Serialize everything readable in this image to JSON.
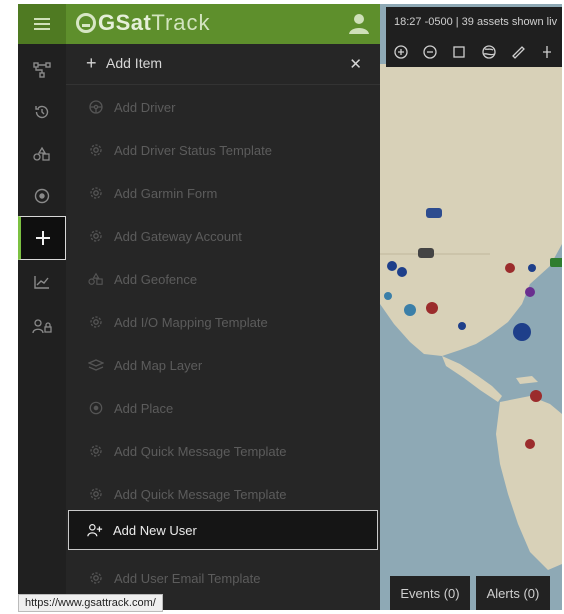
{
  "app": {
    "logo_part1": "GSat",
    "logo_part2": "Track"
  },
  "sidebar": {
    "items": [
      {
        "icon": "hierarchy-icon"
      },
      {
        "icon": "history-icon"
      },
      {
        "icon": "geofence-icon"
      },
      {
        "icon": "place-icon"
      },
      {
        "icon": "plus-icon",
        "active": true
      },
      {
        "icon": "chart-icon"
      },
      {
        "icon": "user-lock-icon"
      }
    ]
  },
  "panel": {
    "title": "Add Item",
    "items": [
      {
        "label": "Add Driver",
        "icon": "steering-wheel-icon"
      },
      {
        "label": "Add Driver Status Template",
        "icon": "gear-icon"
      },
      {
        "label": "Add Garmin Form",
        "icon": "gear-icon"
      },
      {
        "label": "Add Gateway Account",
        "icon": "gear-icon"
      },
      {
        "label": "Add Geofence",
        "icon": "geofence-icon"
      },
      {
        "label": "Add I/O Mapping Template",
        "icon": "gear-icon"
      },
      {
        "label": "Add Map Layer",
        "icon": "layers-icon"
      },
      {
        "label": "Add Place",
        "icon": "place-icon"
      },
      {
        "label": "Add Quick Message Template",
        "icon": "gear-icon"
      },
      {
        "label": "Add Quick Message Template",
        "icon": "gear-icon"
      },
      {
        "label": "Add New User",
        "icon": "user-plus-icon",
        "highlighted": true
      },
      {
        "label": "Add User Email Template",
        "icon": "gear-icon"
      }
    ]
  },
  "map": {
    "status_text": "18:27 -0500 | 39 assets shown liv",
    "events_label": "Events (0)",
    "alerts_label": "Alerts (0)"
  },
  "statusbar": {
    "url": "https://www.gsattrack.com/"
  },
  "colors": {
    "brand_green": "#5e8f2c",
    "active_accent": "#7cc142",
    "panel_bg": "#262626",
    "map_water": "#8ea9b5",
    "map_land": "#d8d1b8"
  }
}
